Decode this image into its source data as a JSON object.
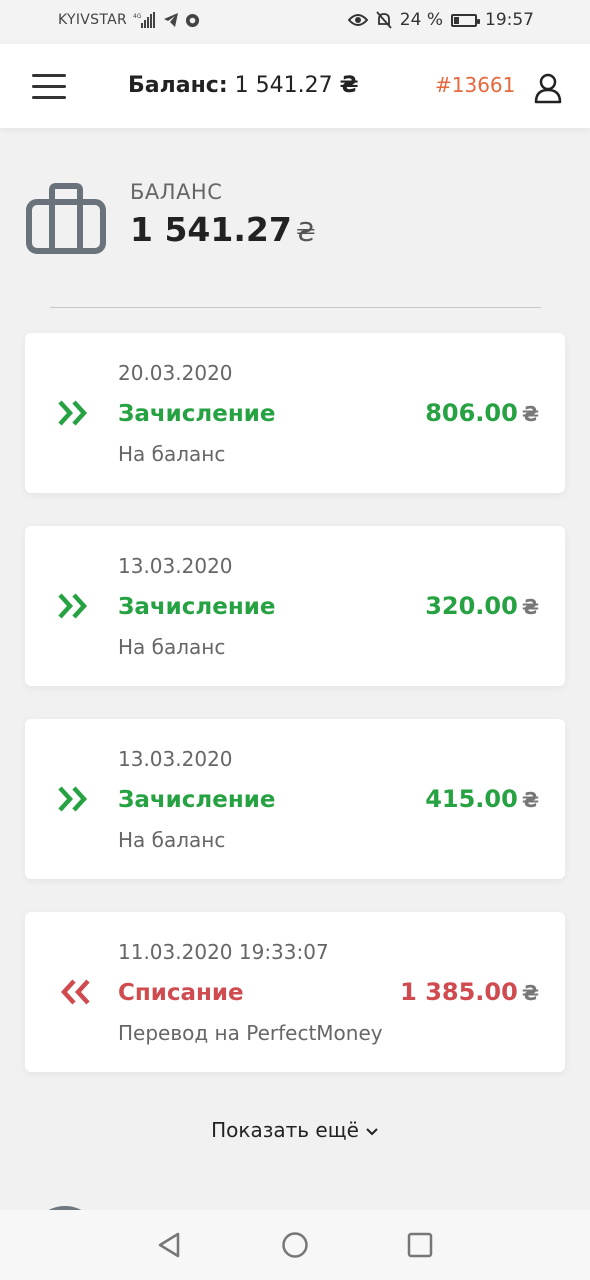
{
  "status_bar": {
    "carrier": "KYIVSTAR",
    "network": "4G",
    "battery_percent": "24 %",
    "battery_level": 0.24,
    "time": "19:57"
  },
  "header": {
    "balance_label": "Баланс:",
    "balance_value": "1 541.27",
    "currency": "₴",
    "account_id": "#13661"
  },
  "balance": {
    "label": "БАЛАНС",
    "amount": "1 541.27",
    "currency": "₴"
  },
  "transactions": [
    {
      "date": "20.03.2020",
      "type": "Зачисление",
      "description": "На баланс",
      "amount": "806.00",
      "currency": "₴",
      "direction": "credit"
    },
    {
      "date": "13.03.2020",
      "type": "Зачисление",
      "description": "На баланс",
      "amount": "320.00",
      "currency": "₴",
      "direction": "credit"
    },
    {
      "date": "13.03.2020",
      "type": "Зачисление",
      "description": "На баланс",
      "amount": "415.00",
      "currency": "₴",
      "direction": "credit"
    },
    {
      "date": "11.03.2020 19:33:07",
      "type": "Списание",
      "description": "Перевод на PerfectMoney",
      "amount": "1 385.00",
      "currency": "₴",
      "direction": "debit"
    }
  ],
  "show_more_label": "Показать ещё",
  "colors": {
    "credit": "#27a243",
    "debit": "#cf4b4f",
    "account_id": "#e6683c"
  },
  "icons": {
    "menu": "hamburger-menu-icon",
    "user": "user-icon",
    "wallet": "briefcase-icon",
    "credit": "double-chevron-right-icon",
    "debit": "double-chevron-left-icon",
    "show_more": "chevron-down-icon",
    "nav_back": "triangle-back-icon",
    "nav_home": "circle-home-icon",
    "nav_recent": "square-recent-icon"
  }
}
